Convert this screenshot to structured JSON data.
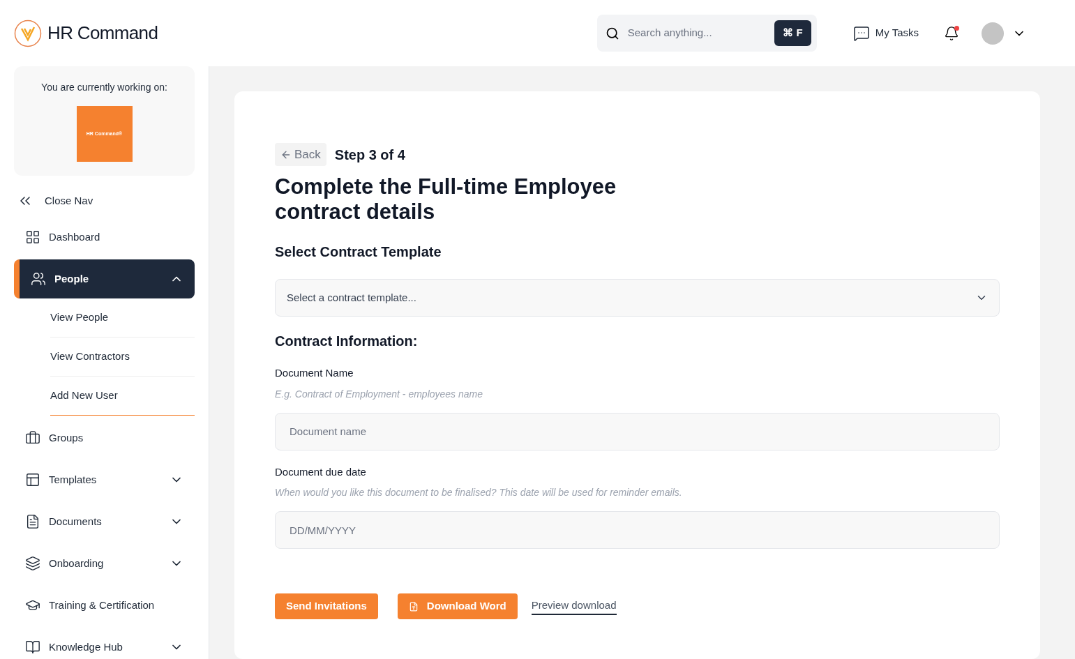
{
  "brand": {
    "name": "HR Command"
  },
  "search": {
    "placeholder": "Search anything...",
    "shortcut": "⌘ F"
  },
  "header": {
    "tasks_label": "My Tasks",
    "has_notifications": true
  },
  "workspace": {
    "caption": "You are currently working on:",
    "logo_text": "HR Command®"
  },
  "close_nav": "Close Nav",
  "nav": [
    {
      "label": "Dashboard",
      "selected": false
    },
    {
      "label": "People",
      "selected": true,
      "expanded": true,
      "children": [
        {
          "label": "View People",
          "selected": false
        },
        {
          "label": "View Contractors",
          "selected": false
        },
        {
          "label": "Add New User",
          "selected": true
        }
      ]
    },
    {
      "label": "Groups",
      "selected": false
    },
    {
      "label": "Templates",
      "selected": false,
      "expanded": false
    },
    {
      "label": "Documents",
      "selected": false,
      "expanded": false
    },
    {
      "label": "Onboarding",
      "selected": false,
      "expanded": false
    },
    {
      "label": "Training & Certification",
      "selected": false
    },
    {
      "label": "Knowledge Hub",
      "selected": false,
      "expanded": false
    }
  ],
  "form": {
    "back": "Back",
    "step": "Step 3 of 4",
    "title": "Complete the Full-time Employee contract details",
    "template_heading": "Select Contract Template",
    "template_placeholder": "Select a contract template...",
    "info_heading": "Contract Information:",
    "fields": [
      {
        "label": "Document Name",
        "hint": "E.g. Contract of Employment - employees name",
        "placeholder": "Document name"
      },
      {
        "label": "Document due date",
        "hint": "When would you like this document to be finalised? This date will be used for reminder emails.",
        "placeholder": "DD/MM/YYYY"
      }
    ],
    "actions": [
      {
        "kind": "primary",
        "label": "Send Invitations"
      },
      {
        "kind": "word",
        "label": "Download Word"
      },
      {
        "kind": "link",
        "label": "Preview download"
      }
    ]
  }
}
